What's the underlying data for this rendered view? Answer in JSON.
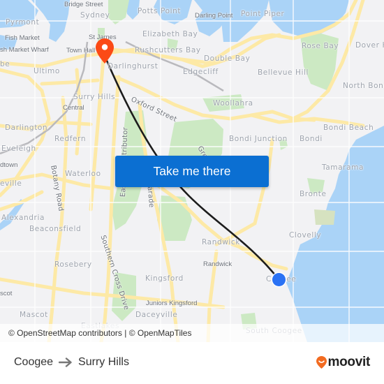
{
  "map": {
    "colors": {
      "land": "#f2f2f4",
      "water": "#aad3f7",
      "park": "#cce9c3",
      "major_road": "#fde9a6",
      "minor_road": "#ffffff",
      "route_line": "#1c1c1c",
      "origin_marker": "#2a72f4",
      "destination_marker": "#fb4a16"
    },
    "labels": {
      "bridge_street": "Bridge Street",
      "sydney": "Sydney",
      "potts_point": "Potts Point",
      "darling_point": "Darling Point",
      "point_piper": "Point Piper",
      "pyrmont": "Pyrmont",
      "fish_market": "Fish Market",
      "fish_market_wharf": "sh Market Wharf",
      "st_james": "St James",
      "elizabeth_bay": "Elizabeth Bay",
      "rose_bay": "Rose Bay",
      "dover_heights": "Dover H",
      "town_hall": "Town Hall",
      "rushcutters_bay": "Rushcutters Bay",
      "double_bay": "Double Bay",
      "glebe": "be",
      "ultimo": "Ultimo",
      "darlinghurst": "Darlinghurst",
      "edgecliff": "Edgecliff",
      "bellevue_hill": "Bellevue Hill",
      "north_bondi": "North Bond",
      "surry_hills": "Surry Hills",
      "oxford_street": "Oxford Street",
      "woollahra": "Woollahra",
      "central": "Central",
      "darlington": "Darlington",
      "bondi_junction": "Bondi Junction",
      "bondi": "Bondi",
      "bondi_beach": "Bondi Beach",
      "redfern": "Redfern",
      "eveleigh": "Eveleigh",
      "eastern_distributor": "Eastern Distributor",
      "green_square_road": "Gre",
      "tamarama": "Tamarama",
      "macdonaldtown": "dtown",
      "botany_road": "Botany Road",
      "waterloo": "Waterloo",
      "anzac_parade": "Anzac Parade",
      "erskineville": "eville",
      "bronte": "Bronte",
      "alexandria": "Alexandria",
      "beaconsfield": "Beaconsfield",
      "southern_cross_drive": "Southern Cross Drive",
      "clovelly": "Clovelly",
      "randwick_suburb": "Randwick",
      "randwick_poi": "Randwick",
      "rosebery": "Rosebery",
      "kingsford": "Kingsford",
      "coogee": "Coogee",
      "mascot_station": "scot",
      "juniors_kingsford": "Juniors Kingsford",
      "mascot": "Mascot",
      "daceyville": "Daceyville",
      "eastlakes": "Eastlakes",
      "south_coogee": "South Coogee"
    },
    "cta_label": "Take me there",
    "attribution": "© OpenStreetMap contributors | © OpenMapTiles"
  },
  "footer": {
    "origin": "Coogee",
    "destination": "Surry Hills",
    "arrow_icon": "arrow-right-icon",
    "brand": "moovit",
    "brand_color": "#f26b21"
  }
}
